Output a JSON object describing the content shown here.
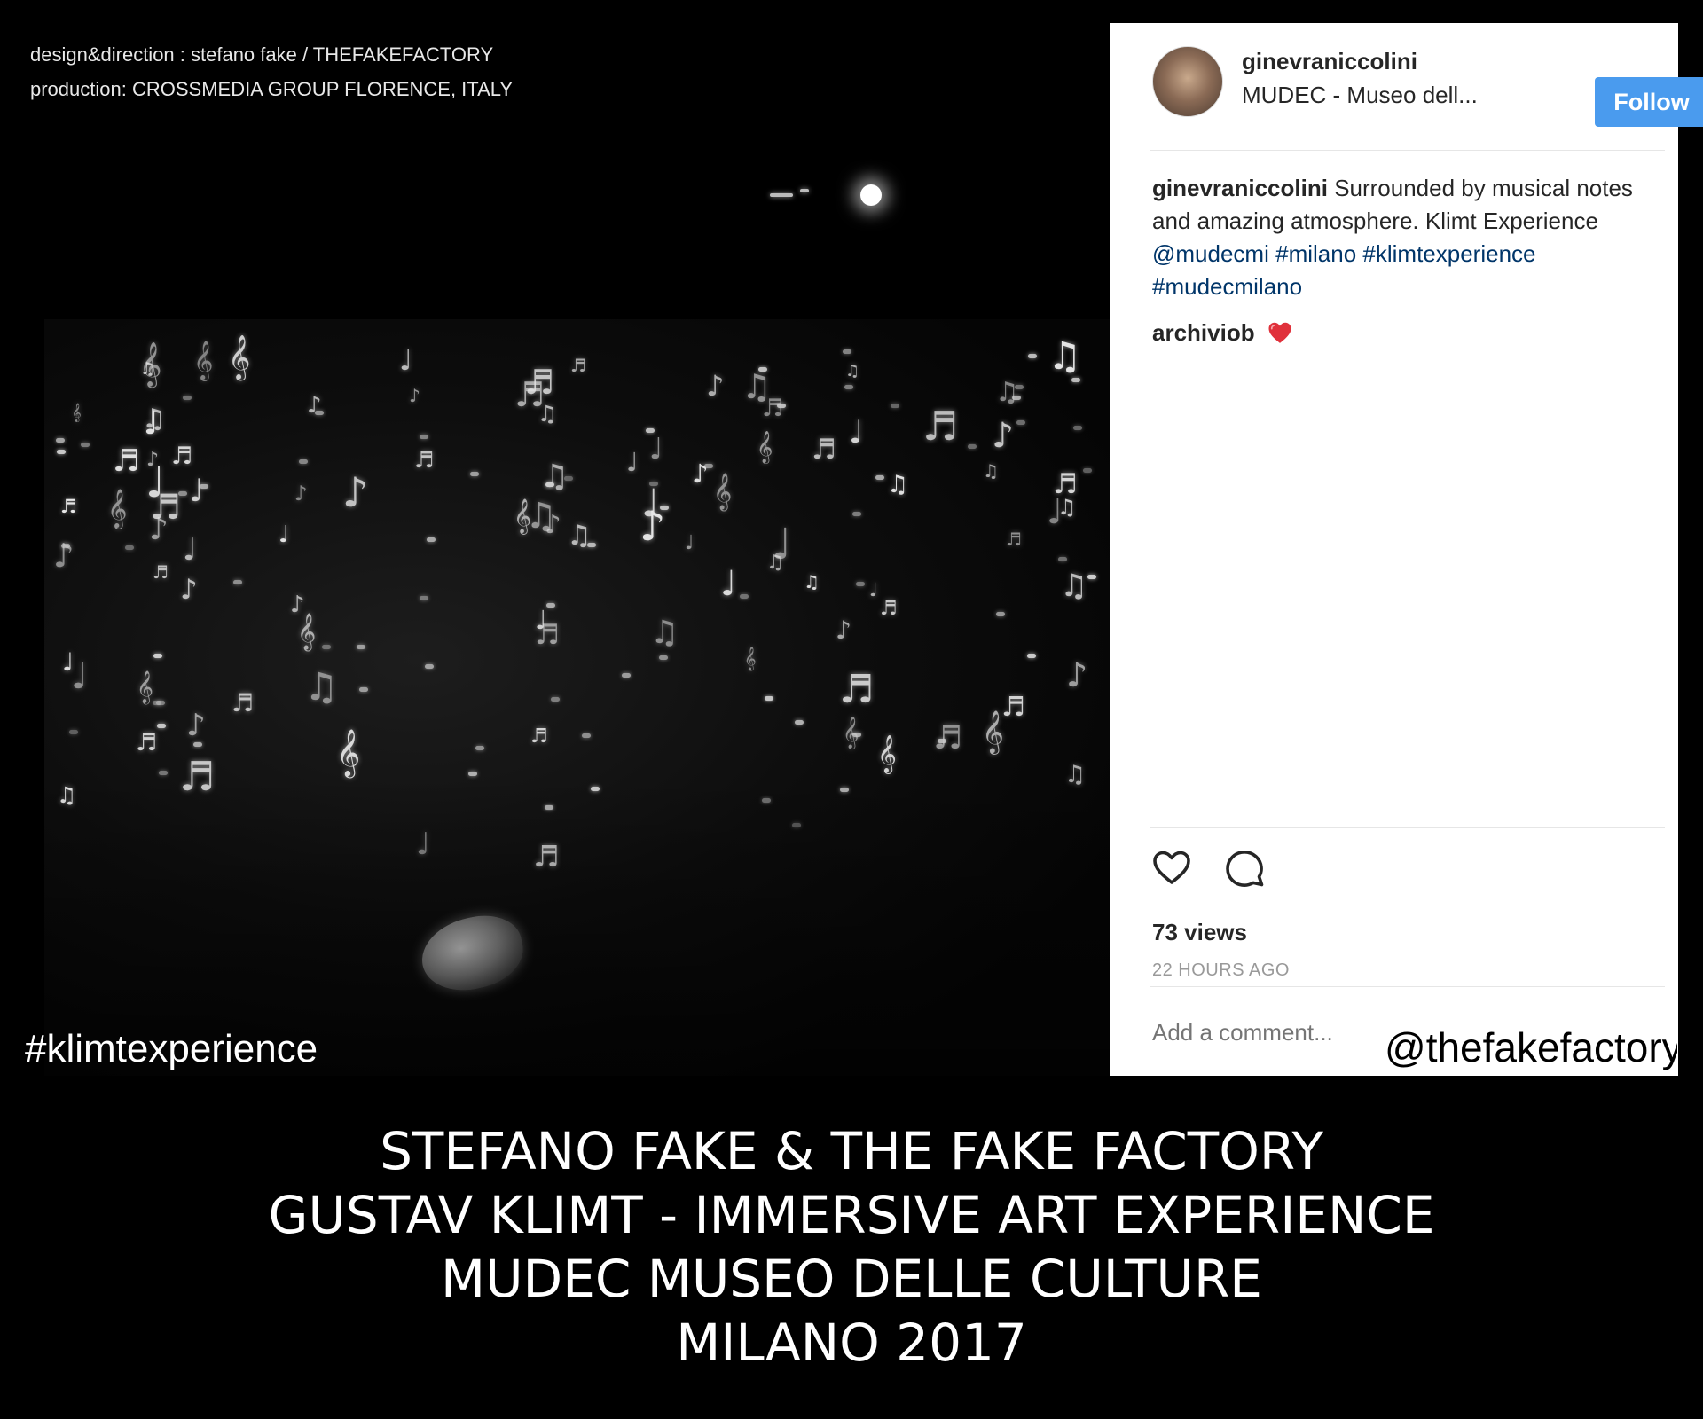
{
  "overlay": {
    "credits": [
      "design&direction : stefano fake / THEFAKEFACTORY",
      "production: CROSSMEDIA GROUP FLORENCE, ITALY"
    ],
    "hashtag": "#klimtexperience"
  },
  "instagram": {
    "username": "ginevraniccolini",
    "location": "MUDEC - Museo dell...",
    "follow_label": "Follow",
    "follow_color": "#4a9bee",
    "caption": {
      "user": "ginevraniccolini",
      "text": "Surrounded by musical notes and amazing atmosphere. Klimt Experience",
      "tag_1": "@mudecmi",
      "tag_2": "#milano",
      "tag_3": "#klimtexperience",
      "tag_4": "#mudecmilano"
    },
    "reply": {
      "user": "archiviob",
      "emoji": "heart-emoji"
    },
    "icons": [
      "heart-icon",
      "comment-icon"
    ],
    "views": "73 views",
    "time_ago": "22 HOURS AGO",
    "comment_placeholder": "Add a comment...",
    "handle": "@thefakefactory"
  },
  "titles": {
    "line1": "STEFANO FAKE & THE FAKE FACTORY",
    "line2": "GUSTAV KLIMT - IMMERSIVE ART EXPERIENCE",
    "line3": "MUDEC MUSEO DELLE CULTURE",
    "line4": "MILANO 2017"
  }
}
